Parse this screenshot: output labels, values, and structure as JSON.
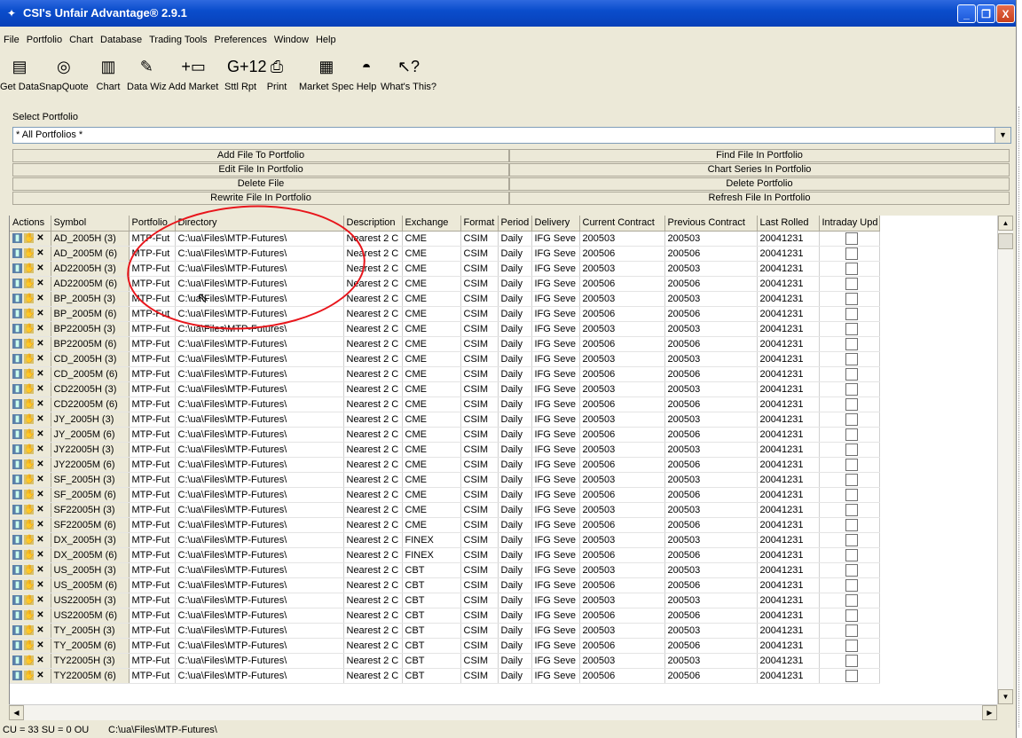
{
  "window": {
    "title": "CSI's Unfair Advantage® 2.9.1",
    "min_label": "_",
    "max_label": "❐",
    "close_label": "X"
  },
  "menu": [
    "File",
    "Portfolio",
    "Chart",
    "Database",
    "Trading Tools",
    "Preferences",
    "Window",
    "Help"
  ],
  "toolbar": [
    {
      "label": "Get Data",
      "icon": "get-data-icon",
      "glyph": "▤"
    },
    {
      "label": "SnapQuote",
      "icon": "snapquote-icon",
      "glyph": "◎"
    },
    {
      "label": "Chart",
      "icon": "chart-icon",
      "glyph": "▥"
    },
    {
      "label": "Data Wiz",
      "icon": "data-wiz-icon",
      "glyph": "✎"
    },
    {
      "label": "Add Market",
      "icon": "add-market-icon",
      "glyph": "+▭"
    },
    {
      "label": "Sttl Rpt",
      "icon": "settlement-report-icon",
      "glyph": "G+12"
    },
    {
      "label": "Print",
      "icon": "print-icon",
      "glyph": "⎙"
    },
    {
      "label": "Market Spec",
      "icon": "market-spec-icon",
      "glyph": "▦"
    },
    {
      "label": "Help",
      "icon": "help-hat-icon",
      "glyph": "◓"
    },
    {
      "label": "What's This?",
      "icon": "whats-this-icon",
      "glyph": "↖?"
    }
  ],
  "portfolio": {
    "label": "Select Portfolio",
    "selected": "* All Portfolios *"
  },
  "actions": {
    "add_file": "Add File To Portfolio",
    "edit_file": "Edit File In Portfolio",
    "delete_file": "Delete File",
    "rewrite_file": "Rewrite File In Portfolio",
    "find_file": "Find File In Portfolio",
    "chart_series": "Chart Series In Portfolio",
    "delete_portfolio": "Delete Portfolio",
    "refresh_file": "Refresh File In Portfolio"
  },
  "table": {
    "columns": [
      "Actions",
      "Symbol",
      "Portfolio",
      "Directory",
      "Description",
      "Exchange",
      "Format",
      "Period",
      "Delivery",
      "Current Contract",
      "Previous Contract",
      "Last Rolled",
      "Intraday Upd"
    ],
    "rows": [
      [
        "AD_2005H (3)",
        "MTP-Fut",
        "C:\\ua\\Files\\MTP-Futures\\",
        "Nearest 2 C",
        "CME",
        "CSIM",
        "Daily",
        "IFG Seve",
        "200503",
        "200503",
        "20041231"
      ],
      [
        "AD_2005M (6)",
        "MTP-Fut",
        "C:\\ua\\Files\\MTP-Futures\\",
        "Nearest 2 C",
        "CME",
        "CSIM",
        "Daily",
        "IFG Seve",
        "200506",
        "200506",
        "20041231"
      ],
      [
        "AD22005H (3)",
        "MTP-Fut",
        "C:\\ua\\Files\\MTP-Futures\\",
        "Nearest 2 C",
        "CME",
        "CSIM",
        "Daily",
        "IFG Seve",
        "200503",
        "200503",
        "20041231"
      ],
      [
        "AD22005M (6)",
        "MTP-Fut",
        "C:\\ua\\Files\\MTP-Futures\\",
        "Nearest 2 C",
        "CME",
        "CSIM",
        "Daily",
        "IFG Seve",
        "200506",
        "200506",
        "20041231"
      ],
      [
        "BP_2005H (3)",
        "MTP-Fut",
        "C:\\ua\\Files\\MTP-Futures\\",
        "Nearest 2 C",
        "CME",
        "CSIM",
        "Daily",
        "IFG Seve",
        "200503",
        "200503",
        "20041231"
      ],
      [
        "BP_2005M (6)",
        "MTP-Fut",
        "C:\\ua\\Files\\MTP-Futures\\",
        "Nearest 2 C",
        "CME",
        "CSIM",
        "Daily",
        "IFG Seve",
        "200506",
        "200506",
        "20041231"
      ],
      [
        "BP22005H (3)",
        "MTP-Fut",
        "C:\\ua\\Files\\MTP-Futures\\",
        "Nearest 2 C",
        "CME",
        "CSIM",
        "Daily",
        "IFG Seve",
        "200503",
        "200503",
        "20041231"
      ],
      [
        "BP22005M (6)",
        "MTP-Fut",
        "C:\\ua\\Files\\MTP-Futures\\",
        "Nearest 2 C",
        "CME",
        "CSIM",
        "Daily",
        "IFG Seve",
        "200506",
        "200506",
        "20041231"
      ],
      [
        "CD_2005H (3)",
        "MTP-Fut",
        "C:\\ua\\Files\\MTP-Futures\\",
        "Nearest 2 C",
        "CME",
        "CSIM",
        "Daily",
        "IFG Seve",
        "200503",
        "200503",
        "20041231"
      ],
      [
        "CD_2005M (6)",
        "MTP-Fut",
        "C:\\ua\\Files\\MTP-Futures\\",
        "Nearest 2 C",
        "CME",
        "CSIM",
        "Daily",
        "IFG Seve",
        "200506",
        "200506",
        "20041231"
      ],
      [
        "CD22005H (3)",
        "MTP-Fut",
        "C:\\ua\\Files\\MTP-Futures\\",
        "Nearest 2 C",
        "CME",
        "CSIM",
        "Daily",
        "IFG Seve",
        "200503",
        "200503",
        "20041231"
      ],
      [
        "CD22005M (6)",
        "MTP-Fut",
        "C:\\ua\\Files\\MTP-Futures\\",
        "Nearest 2 C",
        "CME",
        "CSIM",
        "Daily",
        "IFG Seve",
        "200506",
        "200506",
        "20041231"
      ],
      [
        "JY_2005H (3)",
        "MTP-Fut",
        "C:\\ua\\Files\\MTP-Futures\\",
        "Nearest 2 C",
        "CME",
        "CSIM",
        "Daily",
        "IFG Seve",
        "200503",
        "200503",
        "20041231"
      ],
      [
        "JY_2005M (6)",
        "MTP-Fut",
        "C:\\ua\\Files\\MTP-Futures\\",
        "Nearest 2 C",
        "CME",
        "CSIM",
        "Daily",
        "IFG Seve",
        "200506",
        "200506",
        "20041231"
      ],
      [
        "JY22005H (3)",
        "MTP-Fut",
        "C:\\ua\\Files\\MTP-Futures\\",
        "Nearest 2 C",
        "CME",
        "CSIM",
        "Daily",
        "IFG Seve",
        "200503",
        "200503",
        "20041231"
      ],
      [
        "JY22005M (6)",
        "MTP-Fut",
        "C:\\ua\\Files\\MTP-Futures\\",
        "Nearest 2 C",
        "CME",
        "CSIM",
        "Daily",
        "IFG Seve",
        "200506",
        "200506",
        "20041231"
      ],
      [
        "SF_2005H (3)",
        "MTP-Fut",
        "C:\\ua\\Files\\MTP-Futures\\",
        "Nearest 2 C",
        "CME",
        "CSIM",
        "Daily",
        "IFG Seve",
        "200503",
        "200503",
        "20041231"
      ],
      [
        "SF_2005M (6)",
        "MTP-Fut",
        "C:\\ua\\Files\\MTP-Futures\\",
        "Nearest 2 C",
        "CME",
        "CSIM",
        "Daily",
        "IFG Seve",
        "200506",
        "200506",
        "20041231"
      ],
      [
        "SF22005H (3)",
        "MTP-Fut",
        "C:\\ua\\Files\\MTP-Futures\\",
        "Nearest 2 C",
        "CME",
        "CSIM",
        "Daily",
        "IFG Seve",
        "200503",
        "200503",
        "20041231"
      ],
      [
        "SF22005M (6)",
        "MTP-Fut",
        "C:\\ua\\Files\\MTP-Futures\\",
        "Nearest 2 C",
        "CME",
        "CSIM",
        "Daily",
        "IFG Seve",
        "200506",
        "200506",
        "20041231"
      ],
      [
        "DX_2005H (3)",
        "MTP-Fut",
        "C:\\ua\\Files\\MTP-Futures\\",
        "Nearest 2 C",
        "FINEX",
        "CSIM",
        "Daily",
        "IFG Seve",
        "200503",
        "200503",
        "20041231"
      ],
      [
        "DX_2005M (6)",
        "MTP-Fut",
        "C:\\ua\\Files\\MTP-Futures\\",
        "Nearest 2 C",
        "FINEX",
        "CSIM",
        "Daily",
        "IFG Seve",
        "200506",
        "200506",
        "20041231"
      ],
      [
        "US_2005H (3)",
        "MTP-Fut",
        "C:\\ua\\Files\\MTP-Futures\\",
        "Nearest 2 C",
        "CBT",
        "CSIM",
        "Daily",
        "IFG Seve",
        "200503",
        "200503",
        "20041231"
      ],
      [
        "US_2005M (6)",
        "MTP-Fut",
        "C:\\ua\\Files\\MTP-Futures\\",
        "Nearest 2 C",
        "CBT",
        "CSIM",
        "Daily",
        "IFG Seve",
        "200506",
        "200506",
        "20041231"
      ],
      [
        "US22005H (3)",
        "MTP-Fut",
        "C:\\ua\\Files\\MTP-Futures\\",
        "Nearest 2 C",
        "CBT",
        "CSIM",
        "Daily",
        "IFG Seve",
        "200503",
        "200503",
        "20041231"
      ],
      [
        "US22005M (6)",
        "MTP-Fut",
        "C:\\ua\\Files\\MTP-Futures\\",
        "Nearest 2 C",
        "CBT",
        "CSIM",
        "Daily",
        "IFG Seve",
        "200506",
        "200506",
        "20041231"
      ],
      [
        "TY_2005H (3)",
        "MTP-Fut",
        "C:\\ua\\Files\\MTP-Futures\\",
        "Nearest 2 C",
        "CBT",
        "CSIM",
        "Daily",
        "IFG Seve",
        "200503",
        "200503",
        "20041231"
      ],
      [
        "TY_2005M (6)",
        "MTP-Fut",
        "C:\\ua\\Files\\MTP-Futures\\",
        "Nearest 2 C",
        "CBT",
        "CSIM",
        "Daily",
        "IFG Seve",
        "200506",
        "200506",
        "20041231"
      ],
      [
        "TY22005H (3)",
        "MTP-Fut",
        "C:\\ua\\Files\\MTP-Futures\\",
        "Nearest 2 C",
        "CBT",
        "CSIM",
        "Daily",
        "IFG Seve",
        "200503",
        "200503",
        "20041231"
      ],
      [
        "TY22005M (6)",
        "MTP-Fut",
        "C:\\ua\\Files\\MTP-Futures\\",
        "Nearest 2 C",
        "CBT",
        "CSIM",
        "Daily",
        "IFG Seve",
        "200506",
        "200506",
        "20041231"
      ]
    ]
  },
  "status": {
    "counts": "CU = 33 SU = 0 OU",
    "path": "C:\\ua\\Files\\MTP-Futures\\"
  },
  "colors": {
    "titlebar": "#0a4dcc",
    "annotation_circle": "#e8151b"
  }
}
